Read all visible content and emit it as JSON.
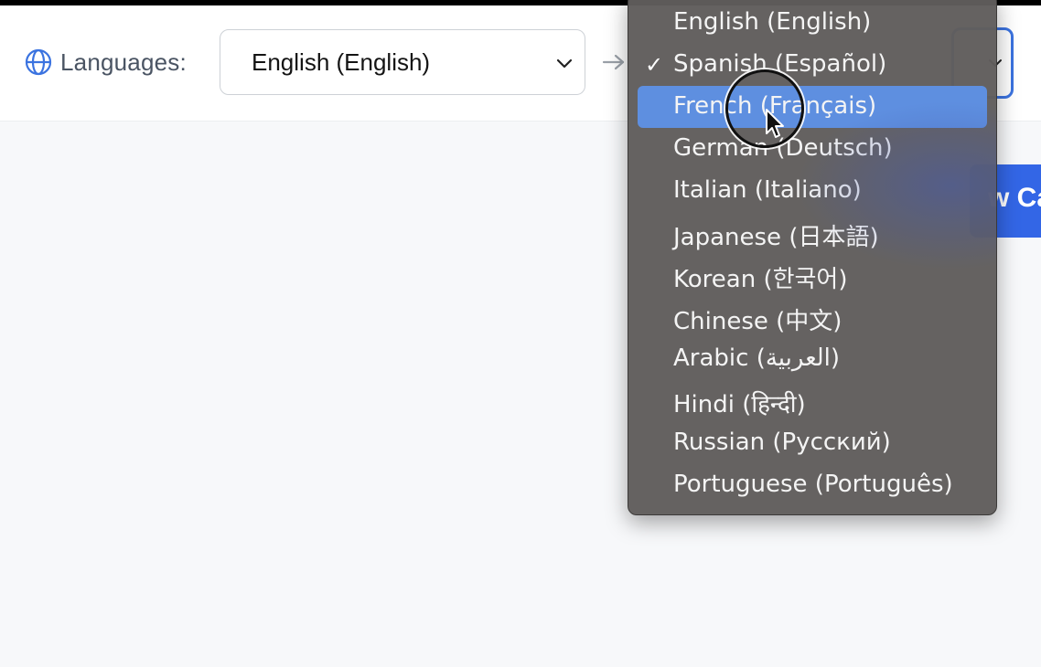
{
  "header": {
    "languages_label": "Languages:",
    "source_language": "English (English)",
    "blue_button_text": "w Ca"
  },
  "dropdown": {
    "selected": "Spanish (Español)",
    "highlighted": "French (Français)",
    "items": [
      "English (English)",
      "Spanish (Español)",
      "French (Français)",
      "German (Deutsch)",
      "Italian (Italiano)",
      "Japanese (日本語)",
      "Korean (한국어)",
      "Chinese (中文)",
      "Arabic (العربية)",
      "Hindi (हिन्दी)",
      "Russian (Русский)",
      "Portuguese (Português)"
    ],
    "check_mark": "✓"
  },
  "icons": {
    "globe": "globe-icon",
    "chevron": "chevron-down-icon",
    "arrow": "arrow-right-icon",
    "check": "check-icon",
    "cursor": "mouse-cursor-icon"
  },
  "colors": {
    "accent": "#3b73e0",
    "menu_bg": "#605d5c",
    "highlight": "#5e8fe0",
    "button": "#3366e6"
  }
}
